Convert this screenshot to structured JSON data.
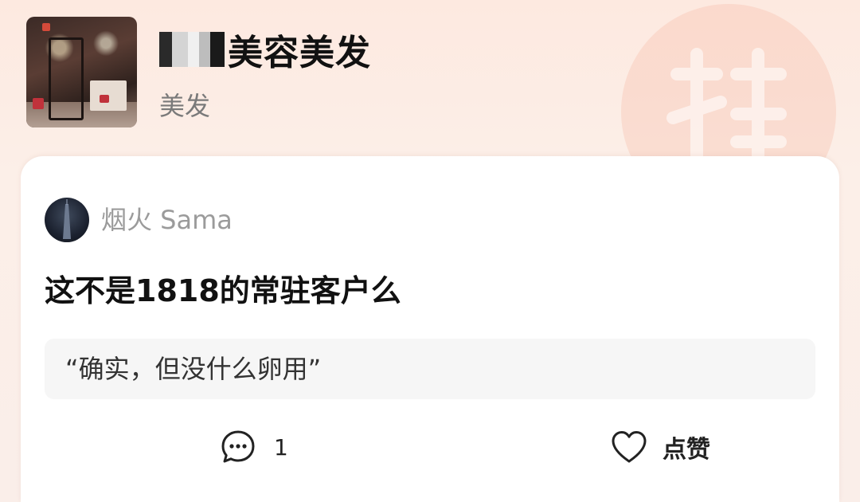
{
  "shop": {
    "title": "美容美发",
    "category": "美发"
  },
  "comment": {
    "author": "烟火 Sama",
    "text": "这不是1818的常驻客户么",
    "quote": "“确实，但没什么卵用”",
    "reply_count": "1",
    "like_label": "点赞"
  },
  "icons": {
    "reply": "comment-bubble-icon",
    "like": "heart-icon"
  },
  "colors": {
    "background": "#fde9e0",
    "card": "#ffffff",
    "quote_background": "#f6f6f6",
    "author_text": "#9b9b9b"
  }
}
